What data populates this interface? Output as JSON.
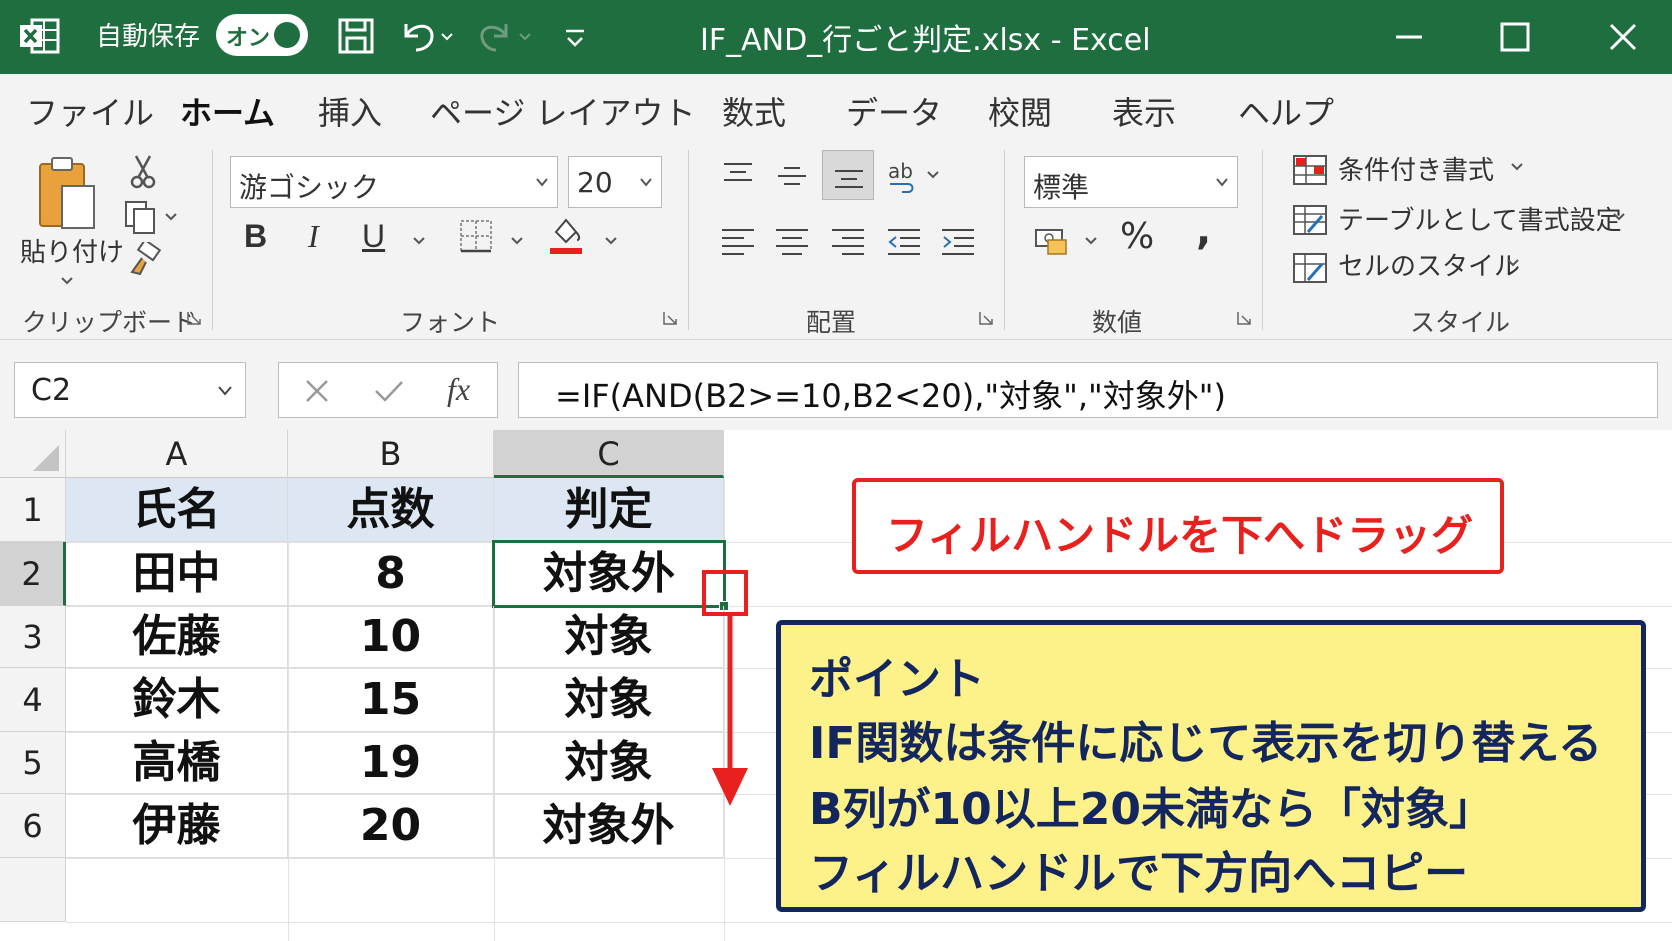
{
  "app": {
    "title": "IF_AND_行ごと判定.xlsx  -  Excel",
    "autosave_label": "自動保存",
    "autosave_state": "オン"
  },
  "menu": {
    "tabs": [
      "ファイル",
      "ホーム",
      "挿入",
      "ページ レイアウト",
      "数式",
      "データ",
      "校閲",
      "表示",
      "ヘルプ"
    ],
    "active_tab": "ホーム"
  },
  "ribbon": {
    "clipboard": {
      "paste_label": "貼り付け",
      "group_label": "クリップボード"
    },
    "font": {
      "font_name": "游ゴシック",
      "font_size": "20",
      "group_label": "フォント",
      "font_color": "#e8201e"
    },
    "alignment": {
      "group_label": "配置"
    },
    "number": {
      "format": "標準",
      "percent": "%",
      "comma": ",",
      "group_label": "数値"
    },
    "styles": {
      "conditional": "条件付き書式",
      "table": "テーブルとして書式設定",
      "cell_style": "セルのスタイル",
      "group_label": "スタイル"
    }
  },
  "formula_bar": {
    "name_box": "C2",
    "fx": "fx",
    "formula": "=IF(AND(B2>=10,B2<20),\"対象\",\"対象外\")"
  },
  "sheet": {
    "columns": [
      "A",
      "B",
      "C"
    ],
    "rows": [
      "1",
      "2",
      "3",
      "4",
      "5",
      "6"
    ],
    "header": [
      "氏名",
      "点数",
      "判定"
    ],
    "data": [
      [
        "田中",
        "8",
        "対象外"
      ],
      [
        "佐藤",
        "10",
        "対象"
      ],
      [
        "鈴木",
        "15",
        "対象"
      ],
      [
        "高橋",
        "19",
        "対象"
      ],
      [
        "伊藤",
        "20",
        "対象外"
      ]
    ],
    "active_cell": "C2"
  },
  "annotations": {
    "drag_hint": "フィルハンドルを下へドラッグ",
    "point_lines": [
      "ポイント",
      "IF関数は条件に応じて表示を切り替える",
      "B列が10以上20未満なら「対象」",
      "フィルハンドルで下方向へコピー"
    ]
  },
  "colors": {
    "excel_green": "#1e6e40",
    "annotation_red": "#e8201e",
    "note_yellow": "#fdf28a",
    "note_navy": "#14265e",
    "header_fill": "#dde7f3"
  }
}
